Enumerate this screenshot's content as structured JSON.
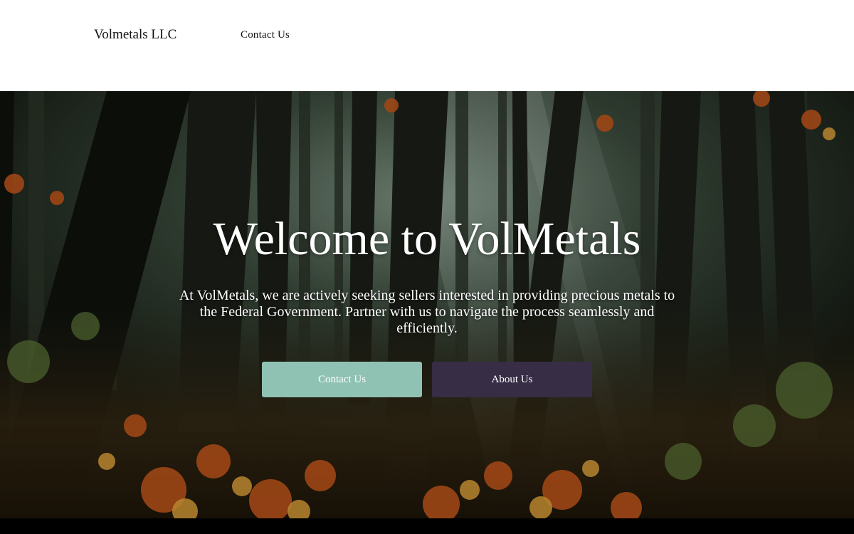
{
  "header": {
    "brand": "Volmetals LLC",
    "nav": [
      {
        "label": "Contact Us"
      }
    ]
  },
  "hero": {
    "title": "Welcome to VolMetals",
    "description": "At VolMetals, we are actively seeking sellers interested in providing precious metals to the Federal Government. Partner with us to navigate the process seamlessly and efficiently.",
    "background": "forest-photo",
    "buttons": [
      {
        "label": "Contact Us",
        "color": "#90c2b3"
      },
      {
        "label": "About Us",
        "color": "#372d45"
      }
    ]
  }
}
